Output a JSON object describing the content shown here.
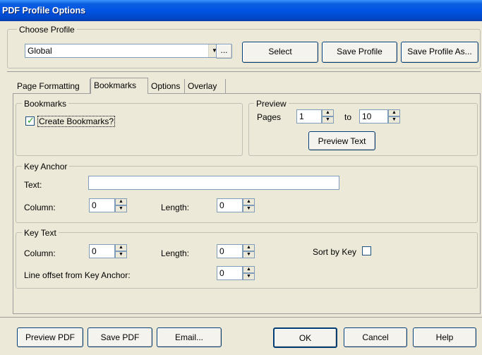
{
  "window": {
    "title": "PDF Profile Options"
  },
  "choose_profile": {
    "group_label": "Choose Profile",
    "selected_profile": "Global",
    "browse_label": "...",
    "select_label": "Select",
    "save_profile_label": "Save Profile",
    "save_profile_as_label": "Save Profile As..."
  },
  "tabs": [
    {
      "label": "Page Formatting"
    },
    {
      "label": "Bookmarks",
      "active": true
    },
    {
      "label": "Options"
    },
    {
      "label": "Overlay"
    }
  ],
  "bookmarks_group": {
    "label": "Bookmarks",
    "create_bookmarks_label": "Create Bookmarks?",
    "create_bookmarks_checked": true
  },
  "preview_group": {
    "label": "Preview",
    "pages_label": "Pages",
    "from_value": "1",
    "to_label": "to",
    "to_value": "10",
    "preview_text_label": "Preview Text"
  },
  "key_anchor": {
    "label": "Key Anchor",
    "text_label": "Text:",
    "text_value": "",
    "column_label": "Column:",
    "column_value": "0",
    "length_label": "Length:",
    "length_value": "0"
  },
  "key_text": {
    "label": "Key Text",
    "column_label": "Column:",
    "column_value": "0",
    "length_label": "Length:",
    "length_value": "0",
    "sort_by_key_label": "Sort by Key",
    "sort_by_key_checked": false,
    "line_offset_label": "Line offset from Key Anchor:",
    "line_offset_value": "0"
  },
  "footer": {
    "preview_pdf_label": "Preview PDF",
    "save_pdf_label": "Save PDF",
    "email_label": "Email...",
    "ok_label": "OK",
    "cancel_label": "Cancel",
    "help_label": "Help"
  }
}
